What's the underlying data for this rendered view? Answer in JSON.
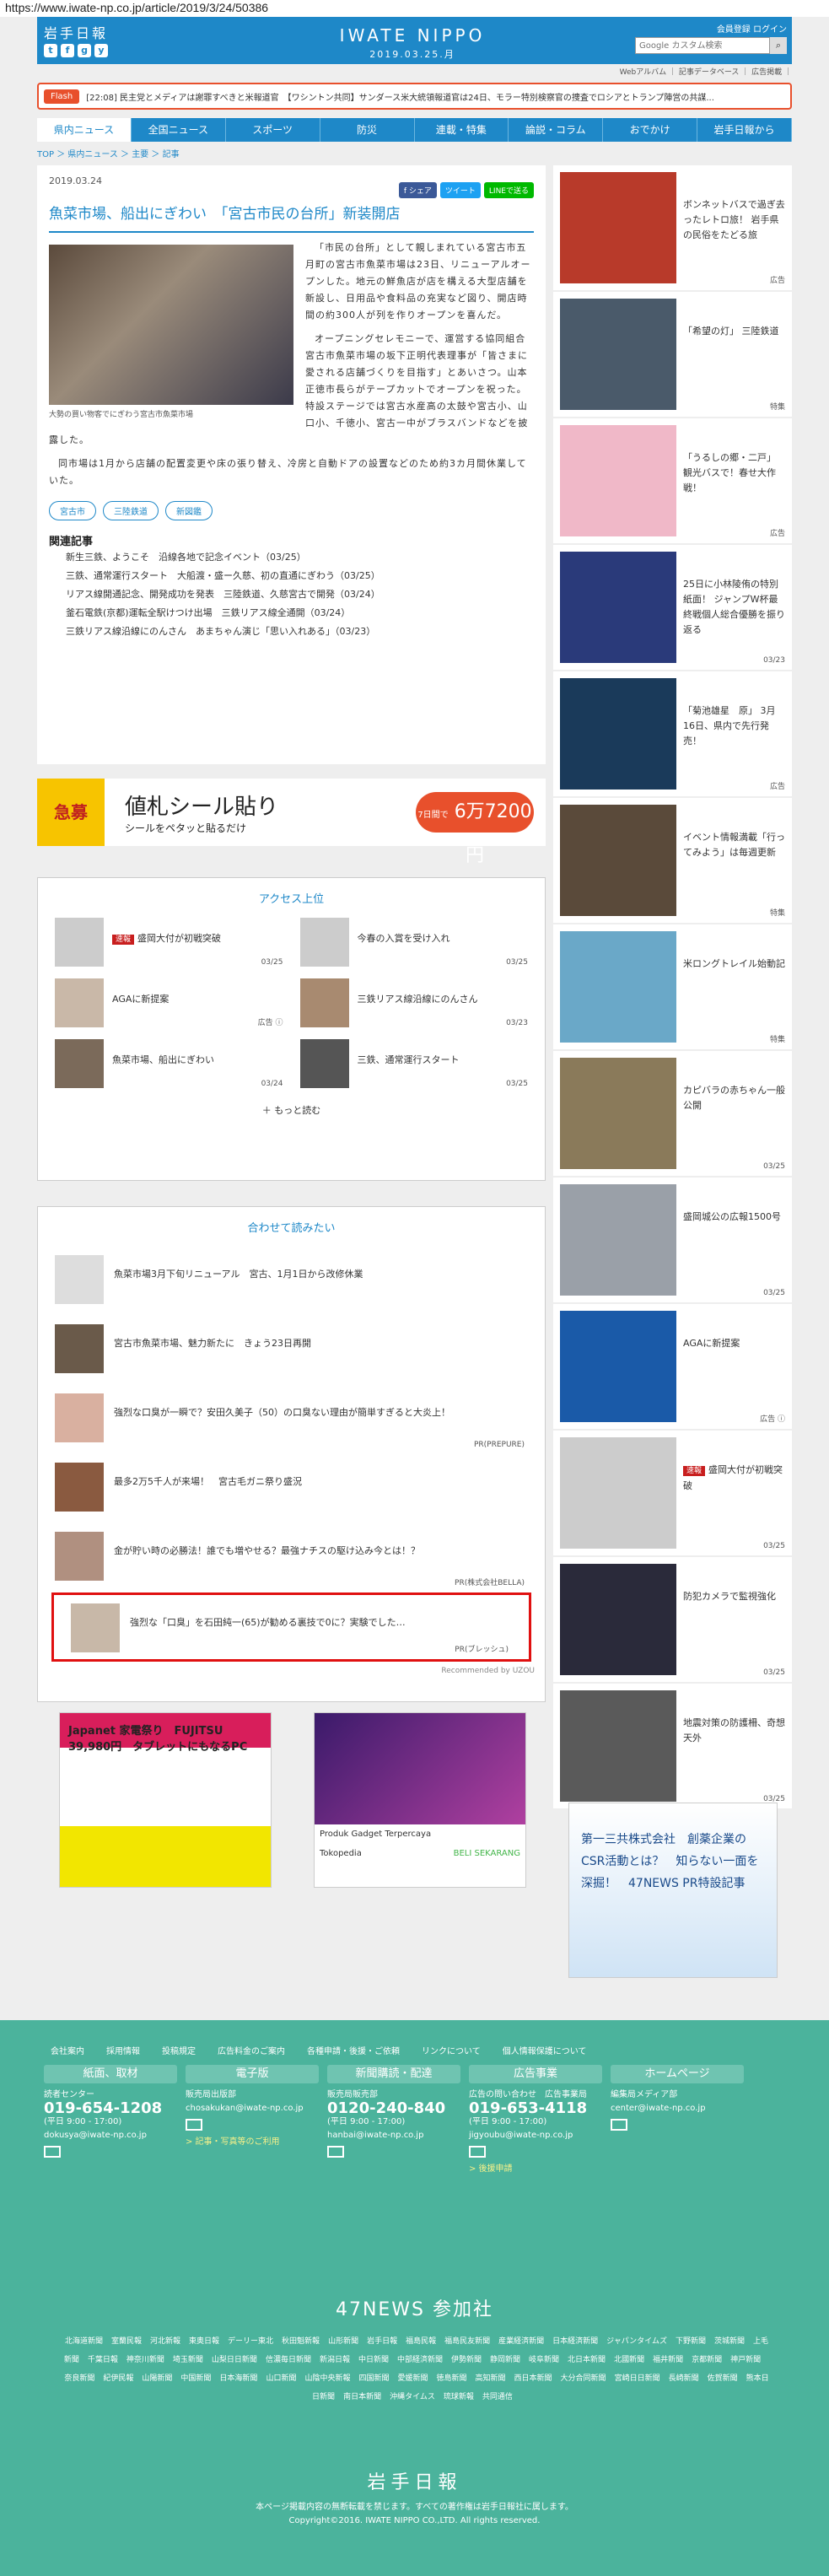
{
  "url": "https://www.iwate-np.co.jp/article/2019/3/24/50386",
  "header": {
    "logo_ja": "岩手日報",
    "logo_en": "IWATE NIPPO",
    "date": "2019.03.25.月",
    "links": "会員登録 ログイン",
    "search_placeholder": "Google カスタム検索",
    "social": [
      "t",
      "f",
      "g",
      "y"
    ]
  },
  "sublinks": "Webアルバム ｜ 記事データベース ｜ 広告掲載 ｜",
  "flash": {
    "badge": "Flash",
    "text": "[22:08] 民主党とメディアは謝罪すべきと米報道官　【ワシントン共同】サンダース米大統領報道官は24日、モラー特別検察官の捜査でロシアとトランプ陣営の共謀..."
  },
  "nav": [
    "県内ニュース",
    "全国ニュース",
    "スポーツ",
    "防災",
    "連載・特集",
    "論説・コラム",
    "おでかけ",
    "岩手日報から"
  ],
  "breadcrumbs": "TOP ＞ 県内ニュース ＞ 主要 ＞ 記事",
  "article": {
    "date": "2019.03.24",
    "share": [
      "f シェア",
      "ツイート",
      "LINEで送る"
    ],
    "title": "魚菜市場、船出にぎわい　「宮古市民の台所」新装開店",
    "caption": "大勢の買い物客でにぎわう宮古市魚菜市場",
    "p1": "「市民の台所」として親しまれている宮古市五月町の宮古市魚菜市場は23日、リニューアルオープンした。地元の鮮魚店が店を構える大型店舗を新設し、日用品や食料品の充実など図り、開店時間の約300人が列を作りオープンを喜んだ。",
    "p2": "オープニングセレモニーで、運営する協同組合宮古市魚菜市場の坂下正明代表理事が「皆さまに愛される店舗づくりを目指す」とあいさつ。山本正徳市長らがテープカットでオープンを祝った。特設ステージでは宮古水産高の太鼓や宮古小、山口小、千徳小、宮古一中がブラスバンドなどを披露した。",
    "p3": "同市場は1月から店舗の配置変更や床の張り替え、冷房と自動ドアの設置などのため約3カ月間休業していた。",
    "tags": [
      "宮古市",
      "三陸鉄道",
      "新図鑑"
    ]
  },
  "related": {
    "heading": "関連記事",
    "items": [
      "新生三鉄、ようこそ　沿線各地で記念イベント（03/25）",
      "三鉄、通常運行スタート　大船渡・盛ー久慈、初の直通にぎわう（03/25）",
      "リアス線開通記念、開発成功を発表　三陸鉄道、久慈宮古で開発（03/24）",
      "釜石電鉄(京都)運転全駅けつけ出場　三鉄リアス線全通開（03/24）",
      "三鉄リアス線沿線にのんさん　あまちゃん演じ「思い入れある」（03/23）"
    ]
  },
  "ad_banner": {
    "left": "急募",
    "main": "値札シール貼り",
    "sub": "シールをペタッと貼るだけ",
    "badge": "6万7200円",
    "badge_small": "7日間で"
  },
  "access": {
    "heading": "アクセス上位",
    "items": [
      {
        "badge": "速報",
        "title": "盛岡大付が初戦突破",
        "date": "03/25"
      },
      {
        "badge": "",
        "title": "今春の入賞を受け入れ",
        "date": "03/25"
      },
      {
        "badge": "",
        "title": "AGAに新提案",
        "date": "広告 ⓘ"
      },
      {
        "badge": "",
        "title": "三鉄リアス線沿線にのんさん",
        "date": "03/23"
      },
      {
        "badge": "",
        "title": "魚菜市場、船出にぎわい",
        "date": "03/24"
      },
      {
        "badge": "",
        "title": "三鉄、通常運行スタート",
        "date": "03/25"
      }
    ],
    "more": "＋ もっと読む"
  },
  "recommend": {
    "heading": "合わせて読みたい",
    "items": [
      {
        "title": "魚菜市場3月下旬リニューアル　宮古、1月1日から改修休業",
        "pr": ""
      },
      {
        "title": "宮古市魚菜市場、魅力新たに　きょう23日再開",
        "pr": ""
      },
      {
        "title": "強烈な口臭が一瞬で？安田久美子（50）の口臭ない理由が簡単すぎると大炎上！",
        "pr": "PR(PREPURE)"
      },
      {
        "title": "最多2万5千人が来場！　宮古毛ガニ祭り盛況",
        "pr": ""
      },
      {
        "title": "金が貯い時の必勝法！誰でも増やせる？最強ナチスの駆け込み今とは！？",
        "pr": "PR(株式会社BELLA)"
      },
      {
        "title": "強烈な「口臭」を石田純一(65)が勧める裏技で0に？実験でした…",
        "pr": "PR(ブレッシュ)"
      }
    ],
    "footer": "Recommended by UZOU"
  },
  "bottom_ads": {
    "left": "Japanet 家電祭り　FUJITSU　39,980円　タブレットにもなるPC",
    "right_title": "Produk Gadget Terpercaya",
    "right_brand": "Tokopedia",
    "right_cta": "BELI SEKARANG"
  },
  "sidebar": {
    "items": [
      {
        "title": "ボンネットバスで過ぎ去ったレトロ旅！ 岩手県の民俗をたどる旅",
        "tag": "広告"
      },
      {
        "title": "「希望の灯」 三陸鉄道",
        "tag": "特集"
      },
      {
        "title": "「うるしの郷・二戸」 観光バスで！春せ大作戦！",
        "tag": "広告"
      },
      {
        "title": "25日に小林陵侑の特別紙面！ ジャンプW杯最終戦個人総合優勝を振り返る",
        "tag": "03/23"
      },
      {
        "title": "「菊池雄星　原」 3月16日、県内で先行発売！",
        "tag": "広告"
      },
      {
        "title": "イベント情報満載「行ってみよう」は毎週更新",
        "tag": "特集"
      },
      {
        "title": "米ロングトレイル始動記",
        "tag": "特集"
      },
      {
        "title": "カピバラの赤ちゃん一般公開",
        "tag": "03/25"
      },
      {
        "title": "盛岡城公の広報1500号",
        "tag": "03/25"
      },
      {
        "title": "AGAに新提案",
        "tag": "広告 ⓘ"
      },
      {
        "title": "盛岡大付が初戦突破",
        "tag": "03/25",
        "badge": "速報"
      },
      {
        "title": "防犯カメラで監視強化",
        "tag": "03/25"
      },
      {
        "title": "地震対策の防護柵、奇想天外",
        "tag": "03/25"
      }
    ],
    "ad_text": "第一三共株式会社　創薬企業のCSR活動とは？　知らない一面を深掘！　47NEWS PR特設記事"
  },
  "footer": {
    "links": [
      "会社案内",
      "採用情報",
      "投稿規定",
      "広告料金のご案内",
      "各種申請・後援・ご依頼",
      "リンクについて",
      "個人情報保護について"
    ],
    "cols": [
      {
        "h": "紙面、取材",
        "label": "読者センター",
        "phone": "019-654-1208",
        "hours": "(平日 9:00 - 17:00)",
        "email": "dokusya@iwate-np.co.jp",
        "extra": ""
      },
      {
        "h": "電子版",
        "label": "販売局出版部",
        "phone": "",
        "hours": "",
        "email": "chosakukan@iwate-np.co.jp",
        "extra": "> 記事・写真等のご利用"
      },
      {
        "h": "新聞購読・配達",
        "label": "販売局販売部",
        "phone": "0120-240-840",
        "hours": "(平日 9:00 - 17:00)",
        "email": "hanbai@iwate-np.co.jp",
        "extra": ""
      },
      {
        "h": "広告事業",
        "label": "広告の問い合わせ　広告事業局",
        "phone": "019-653-4118",
        "hours": "(平日 9:00 - 17:00)",
        "email": "jigyoubu@iwate-np.co.jp",
        "extra": "> 後援申請"
      },
      {
        "h": "ホームページ",
        "label": "編集局メディア部",
        "phone": "",
        "hours": "",
        "email": "center@iwate-np.co.jp",
        "extra": ""
      }
    ],
    "news47": "47NEWS 参加社",
    "papers": [
      "北海道新聞",
      "室蘭民報",
      "河北新報",
      "東奥日報",
      "デーリー東北",
      "秋田魁新報",
      "山形新聞",
      "岩手日報",
      "福島民報",
      "福島民友新聞",
      "産業経済新聞",
      "日本経済新聞",
      "ジャパンタイムズ",
      "下野新聞",
      "茨城新聞",
      "上毛新聞",
      "千葉日報",
      "神奈川新聞",
      "埼玉新聞",
      "山梨日日新聞",
      "信濃毎日新聞",
      "新潟日報",
      "中日新聞",
      "中部経済新聞",
      "伊勢新聞",
      "静岡新聞",
      "岐阜新聞",
      "北日本新聞",
      "北國新聞",
      "福井新聞",
      "京都新聞",
      "神戸新聞",
      "奈良新聞",
      "紀伊民報",
      "山陽新聞",
      "中国新聞",
      "日本海新聞",
      "山口新聞",
      "山陰中央新報",
      "四国新聞",
      "愛媛新聞",
      "徳島新聞",
      "高知新聞",
      "西日本新聞",
      "大分合同新聞",
      "宮崎日日新聞",
      "長崎新聞",
      "佐賀新聞",
      "熊本日日新聞",
      "南日本新聞",
      "沖縄タイムス",
      "琉球新報",
      "共同通信"
    ],
    "logo": "岩手日報",
    "copy1": "本ページ掲載内容の無断転載を禁じます。すべての著作権は岩手日報社に属します。",
    "copy2": "Copyright©2016. IWATE NIPPO CO.,LTD. All rights reserved."
  }
}
